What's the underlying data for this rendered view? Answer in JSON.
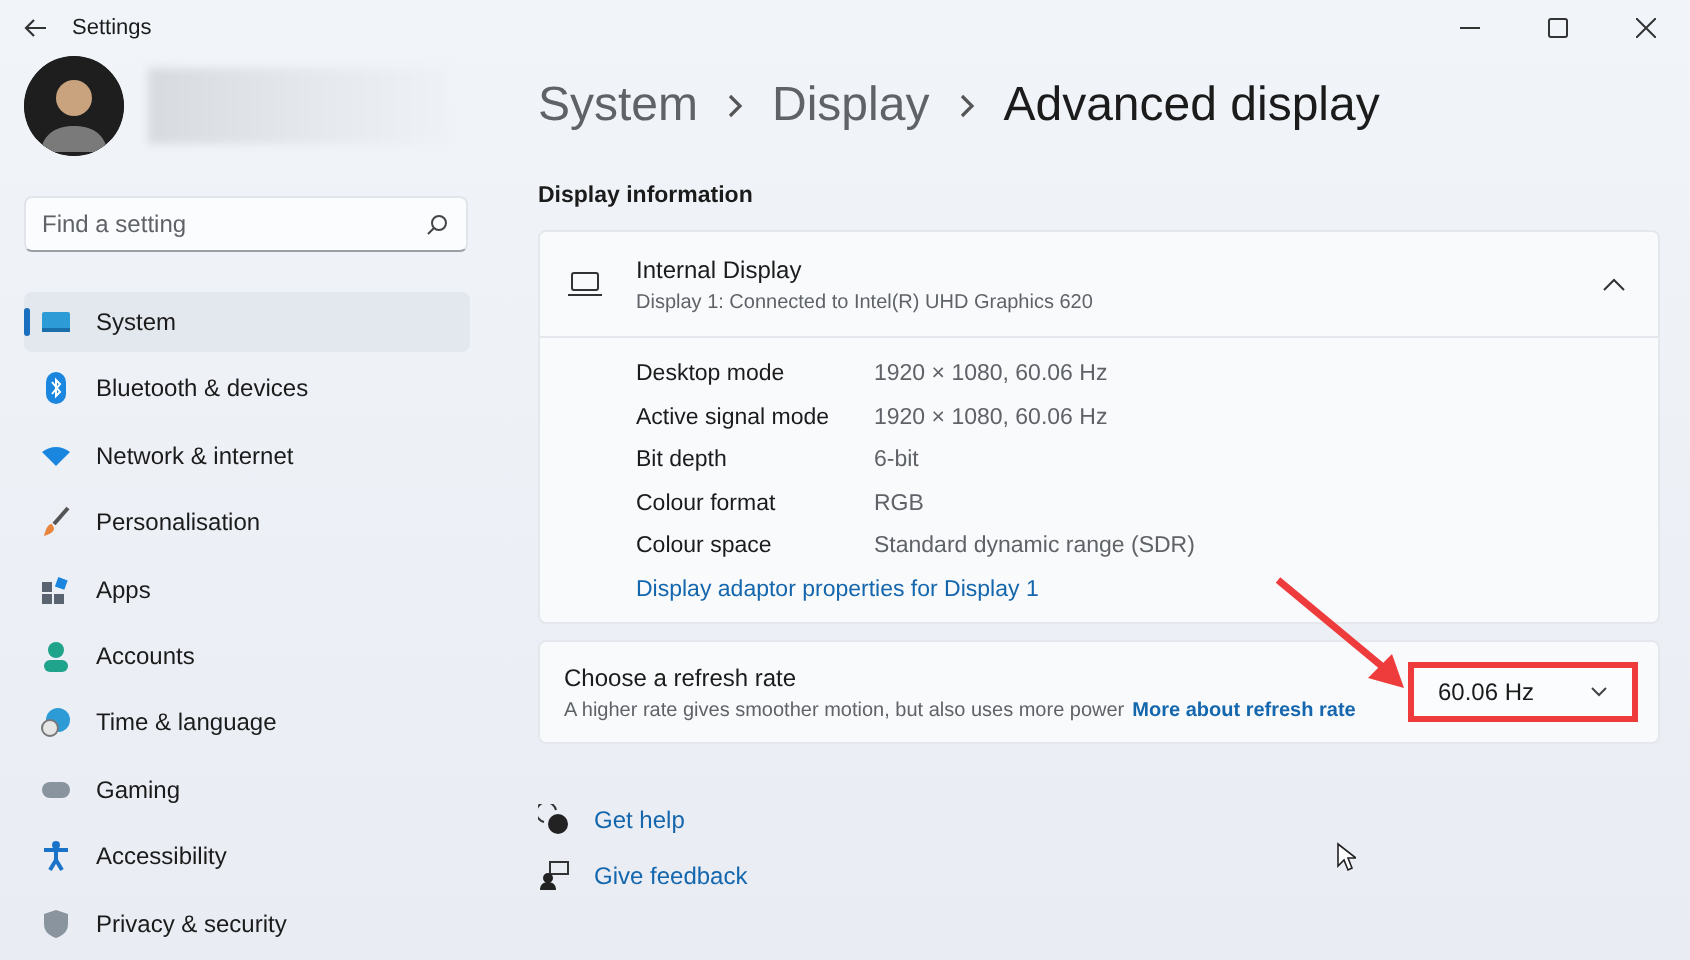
{
  "window": {
    "title": "Settings"
  },
  "search": {
    "placeholder": "Find a setting"
  },
  "sidebar": {
    "items": [
      {
        "label": "System",
        "selected": true
      },
      {
        "label": "Bluetooth & devices",
        "selected": false
      },
      {
        "label": "Network & internet",
        "selected": false
      },
      {
        "label": "Personalisation",
        "selected": false
      },
      {
        "label": "Apps",
        "selected": false
      },
      {
        "label": "Accounts",
        "selected": false
      },
      {
        "label": "Time & language",
        "selected": false
      },
      {
        "label": "Gaming",
        "selected": false
      },
      {
        "label": "Accessibility",
        "selected": false
      },
      {
        "label": "Privacy & security",
        "selected": false
      }
    ]
  },
  "breadcrumb": [
    "System",
    "Display",
    "Advanced display"
  ],
  "section_title": "Display information",
  "display_card": {
    "title": "Internal Display",
    "subtitle": "Display 1: Connected to Intel(R) UHD Graphics 620",
    "expanded": true,
    "details": [
      {
        "label": "Desktop mode",
        "value": "1920 × 1080, 60.06 Hz"
      },
      {
        "label": "Active signal mode",
        "value": "1920 × 1080, 60.06 Hz"
      },
      {
        "label": "Bit depth",
        "value": "6-bit"
      },
      {
        "label": "Colour format",
        "value": "RGB"
      },
      {
        "label": "Colour space",
        "value": "Standard dynamic range (SDR)"
      }
    ],
    "link": "Display adaptor properties for Display 1"
  },
  "refresh_card": {
    "title": "Choose a refresh rate",
    "description": "A higher rate gives smoother motion, but also uses more power",
    "link": "More about refresh rate",
    "dropdown": {
      "value": "60.06 Hz",
      "highlighted": true
    }
  },
  "footer_links": [
    {
      "label": "Get help"
    },
    {
      "label": "Give feedback"
    }
  ]
}
